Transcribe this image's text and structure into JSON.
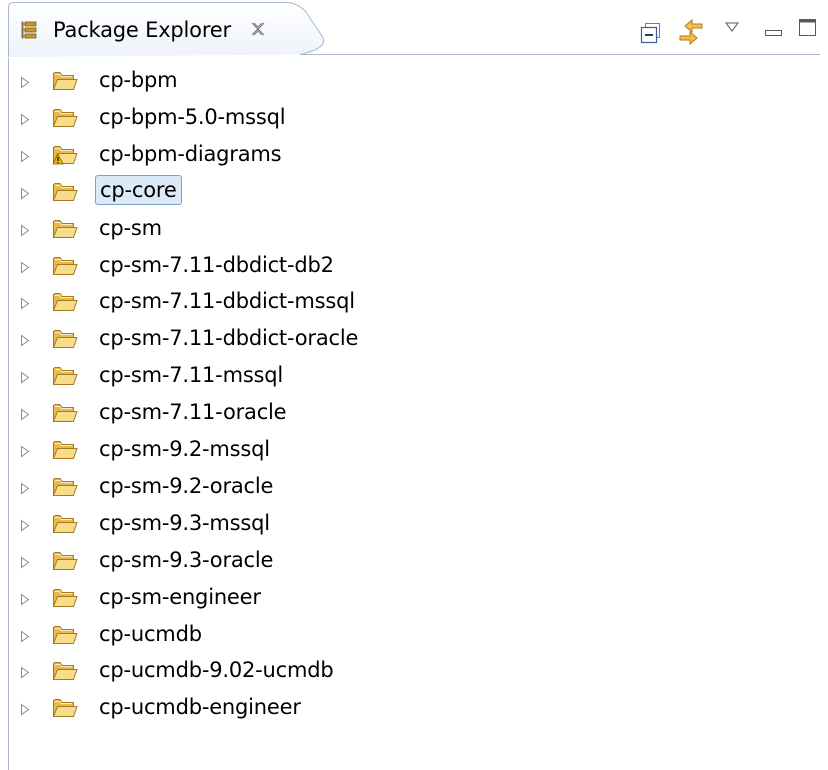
{
  "view": {
    "title": "Package Explorer",
    "close_glyph": "✕",
    "toolbar": [
      {
        "name": "collapse-all-icon"
      },
      {
        "name": "link-with-editor-icon"
      },
      {
        "name": "view-menu-chevron-down-icon"
      },
      {
        "name": "minimize-icon"
      },
      {
        "name": "maximize-icon"
      }
    ]
  },
  "tree": {
    "selected_index": 3,
    "items": [
      {
        "label": "cp-bpm",
        "warning": false
      },
      {
        "label": "cp-bpm-5.0-mssql",
        "warning": false
      },
      {
        "label": "cp-bpm-diagrams",
        "warning": true
      },
      {
        "label": "cp-core",
        "warning": false
      },
      {
        "label": "cp-sm",
        "warning": false
      },
      {
        "label": "cp-sm-7.11-dbdict-db2",
        "warning": false
      },
      {
        "label": "cp-sm-7.11-dbdict-mssql",
        "warning": false
      },
      {
        "label": "cp-sm-7.11-dbdict-oracle",
        "warning": false
      },
      {
        "label": "cp-sm-7.11-mssql",
        "warning": false
      },
      {
        "label": "cp-sm-7.11-oracle",
        "warning": false
      },
      {
        "label": "cp-sm-9.2-mssql",
        "warning": false
      },
      {
        "label": "cp-sm-9.2-oracle",
        "warning": false
      },
      {
        "label": "cp-sm-9.3-mssql",
        "warning": false
      },
      {
        "label": "cp-sm-9.3-oracle",
        "warning": false
      },
      {
        "label": "cp-sm-engineer",
        "warning": false
      },
      {
        "label": "cp-ucmdb",
        "warning": false
      },
      {
        "label": "cp-ucmdb-9.02-ucmdb",
        "warning": false
      },
      {
        "label": "cp-ucmdb-engineer",
        "warning": false
      }
    ]
  },
  "colors": {
    "folder_fill": "#f5d37a",
    "folder_stroke": "#b98a2a",
    "selection_fill": "#dceaf8",
    "selection_border": "#7da2ce",
    "frame_border": "#a9b8cc",
    "warning": "#e8a317"
  }
}
